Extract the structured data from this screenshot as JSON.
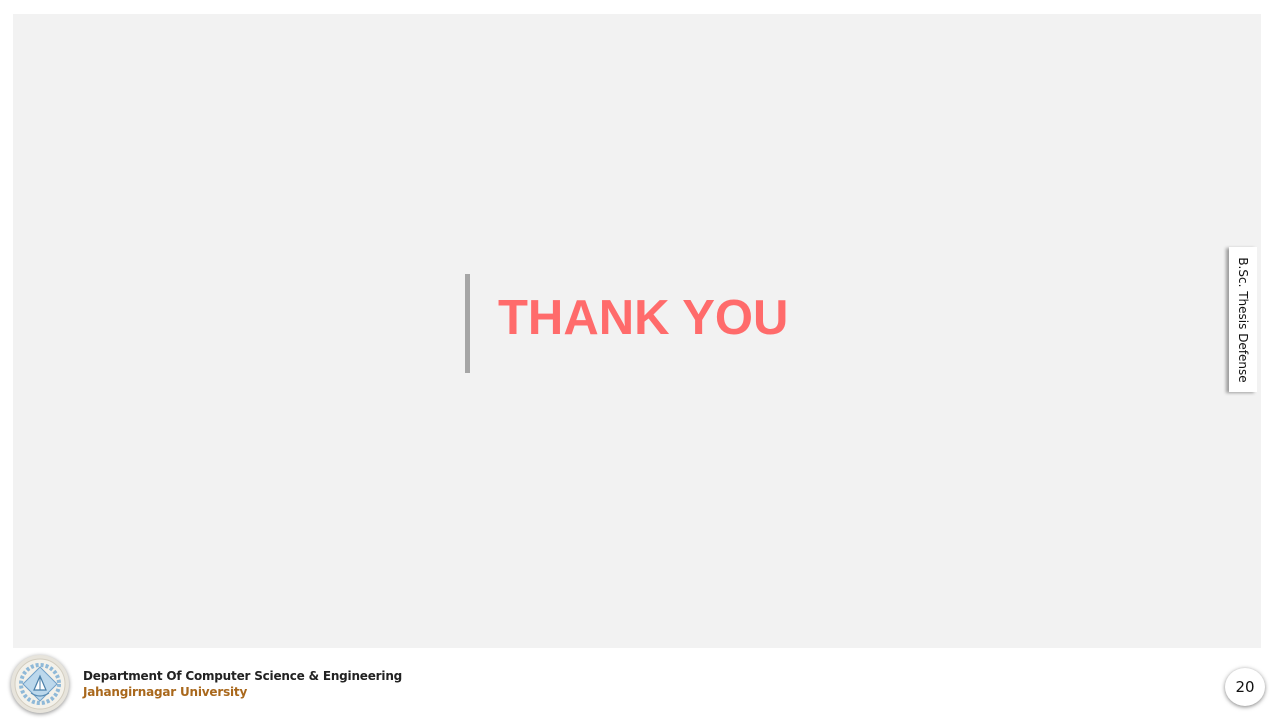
{
  "slide": {
    "title": "THANK YOU",
    "side_tab_label": "B.Sc. Thesis Defense"
  },
  "footer": {
    "logo_icon": "university-seal-icon",
    "department": "Department Of Computer Science & Engineering",
    "university": "Jahangirnagar University",
    "page_number": "20"
  },
  "colors": {
    "title": "#ff6b6b",
    "slide_background": "#f2f2f2",
    "accent_bar": "#a6a6a6",
    "university_text": "#a9681c"
  }
}
